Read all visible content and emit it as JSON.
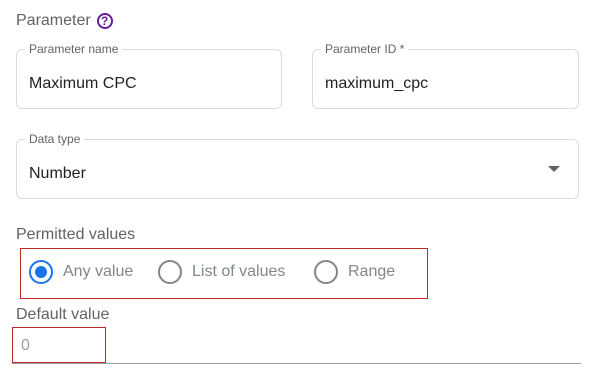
{
  "section": {
    "title": "Parameter",
    "help_icon": "?"
  },
  "parameter_name": {
    "label": "Parameter name",
    "value": "Maximum CPC"
  },
  "parameter_id": {
    "label": "Parameter ID *",
    "value": "maximum_cpc"
  },
  "data_type": {
    "label": "Data type",
    "value": "Number"
  },
  "permitted_values": {
    "label": "Permitted values",
    "options": [
      {
        "label": "Any value",
        "checked": true
      },
      {
        "label": "List of values",
        "checked": false
      },
      {
        "label": "Range",
        "checked": false
      }
    ]
  },
  "default_value": {
    "label": "Default value",
    "value": "0"
  },
  "colors": {
    "accent": "#1a73e8",
    "help": "#6a1b9a",
    "highlight": "#c62828"
  }
}
